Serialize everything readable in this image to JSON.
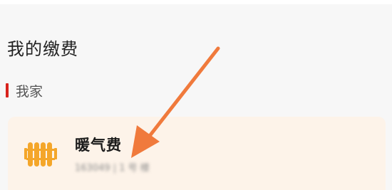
{
  "section": {
    "title": "我的缴费"
  },
  "group": {
    "label": "我家"
  },
  "bill": {
    "name": "暖气费",
    "account": "163049 | 1 号 楼",
    "icon": "radiator-icon"
  },
  "colors": {
    "accent_red": "#d8231d",
    "icon_orange": "#f4a62a",
    "card_bg": "#fdf3e9",
    "arrow": "#f07a3c"
  }
}
